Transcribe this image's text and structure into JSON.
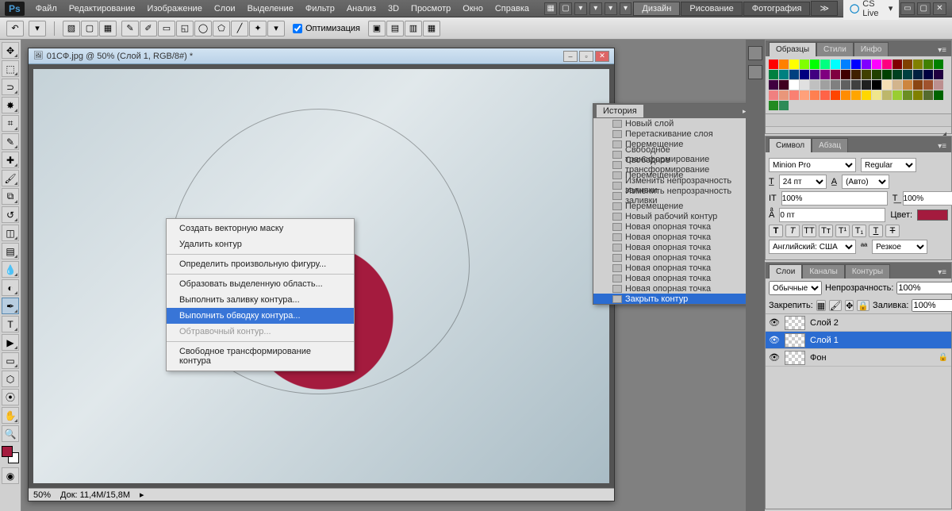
{
  "menubar": {
    "items": [
      "Файл",
      "Редактирование",
      "Изображение",
      "Слои",
      "Выделение",
      "Фильтр",
      "Анализ",
      "3D",
      "Просмотр",
      "Окно",
      "Справка"
    ],
    "workspace_tabs": [
      "Дизайн",
      "Рисование",
      "Фотография"
    ],
    "active_workspace": 0,
    "cslive": "CS Live"
  },
  "options": {
    "optimize_label": "Оптимизация",
    "optimize_checked": true
  },
  "document": {
    "title": "01СФ.jpg @ 50% (Слой 1, RGB/8#) *",
    "zoom": "50%",
    "status": "Док: 11,4M/15,8M"
  },
  "context_menu": {
    "items": [
      {
        "label": "Создать векторную маску",
        "disabled": false
      },
      {
        "label": "Удалить контур",
        "disabled": false
      },
      {
        "sep": true
      },
      {
        "label": "Определить произвольную фигуру...",
        "disabled": false
      },
      {
        "sep": true
      },
      {
        "label": "Образовать выделенную область...",
        "disabled": false
      },
      {
        "label": "Выполнить заливку контура...",
        "disabled": false
      },
      {
        "label": "Выполнить обводку контура...",
        "disabled": false,
        "hl": true
      },
      {
        "label": "Обтравочный контур...",
        "disabled": true
      },
      {
        "sep": true
      },
      {
        "label": "Свободное трансформирование контура",
        "disabled": false
      }
    ]
  },
  "history": {
    "title": "История",
    "items": [
      "Новый слой",
      "Перетаскивание слоя",
      "Перемещение",
      "Свободное трансформирование",
      "Свободное трансформирование",
      "Перемещение",
      "Изменить непрозрачность заливки",
      "Изменить непрозрачность заливки",
      "Перемещение",
      "Новый рабочий контур",
      "Новая опорная точка",
      "Новая опорная точка",
      "Новая опорная точка",
      "Новая опорная точка",
      "Новая опорная точка",
      "Новая опорная точка",
      "Новая опорная точка",
      "Закрыть контур"
    ],
    "selected_index": 17
  },
  "swatches": {
    "tabs": [
      "Образцы",
      "Стили",
      "Инфо"
    ],
    "colors": [
      "#ff0000",
      "#ff8000",
      "#ffff00",
      "#80ff00",
      "#00ff00",
      "#00ff80",
      "#00ffff",
      "#0080ff",
      "#0000ff",
      "#8000ff",
      "#ff00ff",
      "#ff0080",
      "#800000",
      "#804000",
      "#808000",
      "#408000",
      "#008000",
      "#008040",
      "#008080",
      "#004080",
      "#000080",
      "#400080",
      "#800080",
      "#800040",
      "#400000",
      "#402000",
      "#404000",
      "#204000",
      "#004000",
      "#004020",
      "#004040",
      "#002040",
      "#000040",
      "#200040",
      "#400040",
      "#400020",
      "#ffffff",
      "#e0e0e0",
      "#c0c0c0",
      "#a0a0a0",
      "#808080",
      "#606060",
      "#404040",
      "#202020",
      "#000000",
      "#f5deb3",
      "#d2b48c",
      "#cd853f",
      "#8b4513",
      "#a0522d",
      "#bc8f8f",
      "#f08080",
      "#e9967a",
      "#fa8072",
      "#ffa07a",
      "#ff7f50",
      "#ff6347",
      "#ff4500",
      "#ff8c00",
      "#ffa500",
      "#ffd700",
      "#f0e68c",
      "#bdb76b",
      "#9acd32",
      "#6b8e23",
      "#808000",
      "#556b2f",
      "#006400",
      "#228b22",
      "#2e8b57"
    ]
  },
  "character": {
    "tabs": [
      "Символ",
      "Абзац"
    ],
    "font": "Minion Pro",
    "style": "Regular",
    "size": "24 пт",
    "leading": "(Авто)",
    "tracking_v": "100%",
    "tracking_h": "100%",
    "baseline": "0 пт",
    "color_label": "Цвет:",
    "color": "#a41b3e",
    "language": "Английский: США",
    "aa": "Резкое"
  },
  "layers": {
    "tabs": [
      "Слои",
      "Каналы",
      "Контуры"
    ],
    "blend": "Обычные",
    "opacity_label": "Непрозрачность:",
    "opacity": "100%",
    "lock_label": "Закрепить:",
    "fill_label": "Заливка:",
    "fill": "100%",
    "rows": [
      {
        "name": "Слой 2",
        "sel": false
      },
      {
        "name": "Слой 1",
        "sel": true
      },
      {
        "name": "Фон",
        "sel": false,
        "locked": true
      }
    ]
  }
}
